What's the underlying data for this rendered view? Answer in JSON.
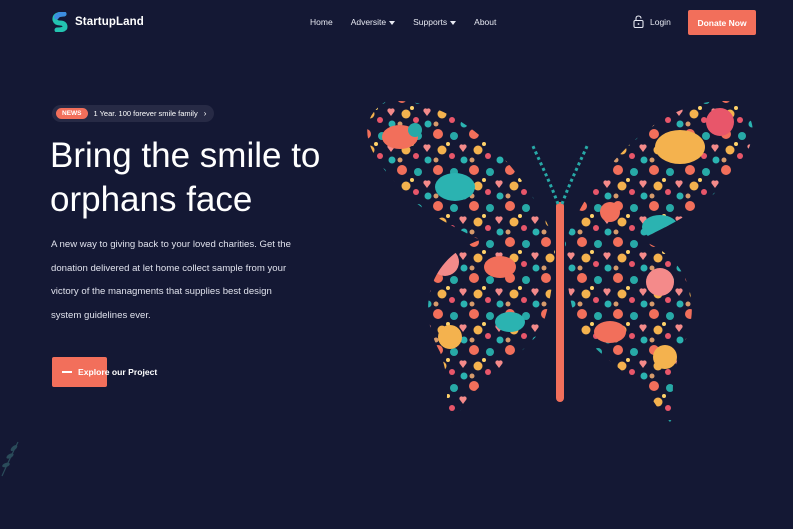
{
  "brand": {
    "name": "StartupLand",
    "logo_icon": "s-logo-icon",
    "accent": "#f26f5b",
    "background": "#141834"
  },
  "nav": {
    "items": [
      {
        "label": "Home",
        "dropdown": false
      },
      {
        "label": "Adversite",
        "dropdown": true
      },
      {
        "label": "Supports",
        "dropdown": true
      },
      {
        "label": "About",
        "dropdown": false
      }
    ],
    "login_label": "Login",
    "login_icon": "lock-icon",
    "donate_label": "Donate Now"
  },
  "hero": {
    "news_tag": "NEWS",
    "news_text": "1 Year. 100 forever smile family",
    "headline_lines": [
      "Bring the smile to",
      "orphans face"
    ],
    "description_lines": [
      "A new way to giving back to your loved charities. Get the",
      "donation delivered at let home collect sample from your",
      "victory of the managments that supplies best design",
      "system guidelines ever."
    ],
    "cta_label": "Explore our Project",
    "illustration": "colorful-butterfly-made-of-birds-hearts-flowers"
  }
}
